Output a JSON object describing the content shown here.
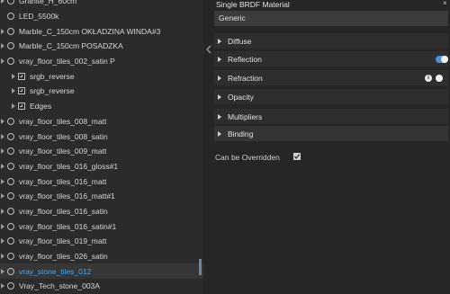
{
  "material_tree": {
    "items": [
      {
        "label": "Granite_H_60cm",
        "kind": "material",
        "expandable": true,
        "selected": false,
        "level": 0
      },
      {
        "label": "LED_5500k",
        "kind": "material",
        "expandable": false,
        "selected": false,
        "level": 0
      },
      {
        "label": "Marble_C_150cm OKŁADZINA WINDA#3",
        "kind": "material",
        "expandable": true,
        "selected": false,
        "level": 0
      },
      {
        "label": "Marble_C_150cm POSADZKA",
        "kind": "material",
        "expandable": true,
        "selected": false,
        "level": 0
      },
      {
        "label": "vray_floor_tiles_002_satin P",
        "kind": "material",
        "expandable": true,
        "selected": false,
        "level": 0
      },
      {
        "label": "srgb_reverse",
        "kind": "texture",
        "expandable": true,
        "selected": false,
        "level": 1
      },
      {
        "label": "srgb_reverse",
        "kind": "texture",
        "expandable": true,
        "selected": false,
        "level": 1
      },
      {
        "label": "Edges",
        "kind": "texture",
        "expandable": true,
        "selected": false,
        "level": 1
      },
      {
        "label": "vray_floor_tiles_008_matt",
        "kind": "material",
        "expandable": true,
        "selected": false,
        "level": 0
      },
      {
        "label": "vray_floor_tiles_008_satin",
        "kind": "material",
        "expandable": true,
        "selected": false,
        "level": 0
      },
      {
        "label": "vray_floor_tiles_009_matt",
        "kind": "material",
        "expandable": true,
        "selected": false,
        "level": 0
      },
      {
        "label": "vray_floor_tiles_016_gloss#1",
        "kind": "material",
        "expandable": true,
        "selected": false,
        "level": 0
      },
      {
        "label": "vray_floor_tiles_016_matt",
        "kind": "material",
        "expandable": true,
        "selected": false,
        "level": 0
      },
      {
        "label": "vray_floor_tiles_016_matt#1",
        "kind": "material",
        "expandable": true,
        "selected": false,
        "level": 0
      },
      {
        "label": "vray_floor_tiles_016_satin",
        "kind": "material",
        "expandable": true,
        "selected": false,
        "level": 0
      },
      {
        "label": "vray_floor_tiles_016_satin#1",
        "kind": "material",
        "expandable": true,
        "selected": false,
        "level": 0
      },
      {
        "label": "vray_floor_tiles_019_matt",
        "kind": "material",
        "expandable": true,
        "selected": false,
        "level": 0
      },
      {
        "label": "vray_floor_tiles_026_satin",
        "kind": "material",
        "expandable": true,
        "selected": false,
        "level": 0
      },
      {
        "label": "vray_stone_tiles_012",
        "kind": "material",
        "expandable": true,
        "selected": true,
        "level": 0
      },
      {
        "label": "Vray_Tech_stone_003A",
        "kind": "material",
        "expandable": true,
        "selected": false,
        "level": 0
      }
    ]
  },
  "properties": {
    "title": "Single BRDF Material",
    "preset": "Generic",
    "sections": [
      {
        "label": "Diffuse",
        "toggle": null,
        "info": false
      },
      {
        "label": "Reflection",
        "toggle": "on",
        "info": false
      },
      {
        "label": "Refraction",
        "toggle": "off",
        "info": true
      },
      {
        "label": "Opacity",
        "toggle": null,
        "info": false
      },
      {
        "label": "Multipliers",
        "toggle": null,
        "info": false
      },
      {
        "label": "Binding",
        "toggle": null,
        "info": false
      }
    ],
    "info_glyph": "i",
    "close_glyph": "×",
    "override_label": "Can be Overridden",
    "override_checked": true
  },
  "colors": {
    "selection_text": "#4fa3e6",
    "toggle_on": "#4a90d9",
    "panel_bg": "#262626"
  }
}
